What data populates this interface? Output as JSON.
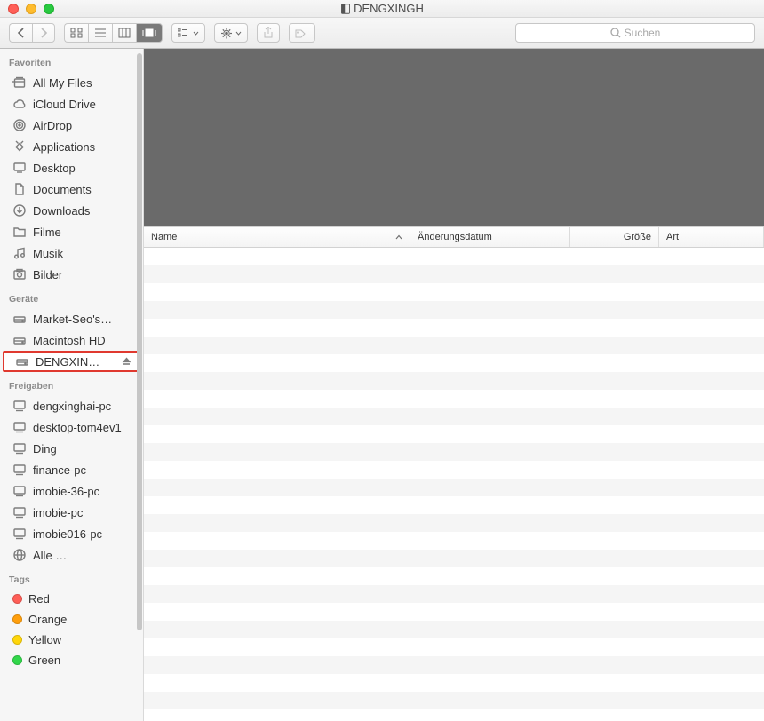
{
  "window": {
    "title": "DENGXINGH"
  },
  "toolbar": {
    "search_placeholder": "Suchen"
  },
  "sidebar": {
    "favorites": {
      "heading": "Favoriten",
      "items": [
        {
          "icon": "all-my-files",
          "label": "All My Files"
        },
        {
          "icon": "cloud",
          "label": "iCloud Drive"
        },
        {
          "icon": "airdrop",
          "label": "AirDrop"
        },
        {
          "icon": "applications",
          "label": "Applications"
        },
        {
          "icon": "desktop",
          "label": "Desktop"
        },
        {
          "icon": "documents",
          "label": "Documents"
        },
        {
          "icon": "downloads",
          "label": "Downloads"
        },
        {
          "icon": "folder",
          "label": "Filme"
        },
        {
          "icon": "music",
          "label": "Musik"
        },
        {
          "icon": "pictures",
          "label": "Bilder"
        }
      ]
    },
    "devices": {
      "heading": "Geräte",
      "items": [
        {
          "icon": "drive",
          "label": "Market-Seo's…"
        },
        {
          "icon": "drive",
          "label": "Macintosh HD"
        },
        {
          "icon": "drive",
          "label": "DENGXIN…",
          "eject": true,
          "selected": true
        }
      ]
    },
    "shared": {
      "heading": "Freigaben",
      "items": [
        {
          "icon": "computer",
          "label": "dengxinghai-pc"
        },
        {
          "icon": "computer",
          "label": "desktop-tom4ev1"
        },
        {
          "icon": "computer",
          "label": "Ding"
        },
        {
          "icon": "computer",
          "label": "finance-pc"
        },
        {
          "icon": "computer",
          "label": "imobie-36-pc"
        },
        {
          "icon": "computer",
          "label": "imobie-pc"
        },
        {
          "icon": "computer",
          "label": "imobie016-pc"
        },
        {
          "icon": "globe",
          "label": "Alle …"
        }
      ]
    },
    "tags": {
      "heading": "Tags",
      "items": [
        {
          "color": "#ff5f57",
          "label": "Red"
        },
        {
          "color": "#ff9f0d",
          "label": "Orange"
        },
        {
          "color": "#ffd60a",
          "label": "Yellow"
        },
        {
          "color": "#32d74b",
          "label": "Green"
        }
      ]
    }
  },
  "columns": {
    "name": "Name",
    "date": "Änderungsdatum",
    "size": "Größe",
    "kind": "Art"
  }
}
